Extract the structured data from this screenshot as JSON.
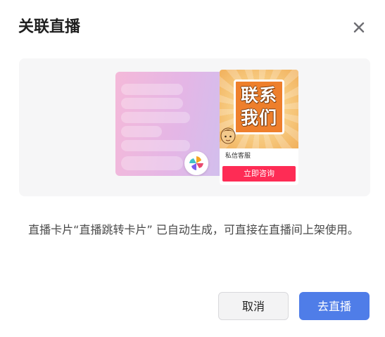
{
  "dialog": {
    "title": "关联直播",
    "close_icon": "close-icon"
  },
  "preview": {
    "card_title_line1": "联系",
    "card_title_line2": "我们",
    "card_name": "私信客服",
    "card_button": "立即咨询",
    "app_logo_icon": "pinwheel-logo-icon"
  },
  "description": "直播卡片“直播跳转卡片” 已自动生成，可直接在直播间上架使用。",
  "actions": {
    "cancel_label": "取消",
    "confirm_label": "去直播"
  },
  "colors": {
    "primary": "#4f7de8",
    "card_button": "#fe2c55",
    "badge_orange": "#ee7f2c"
  }
}
